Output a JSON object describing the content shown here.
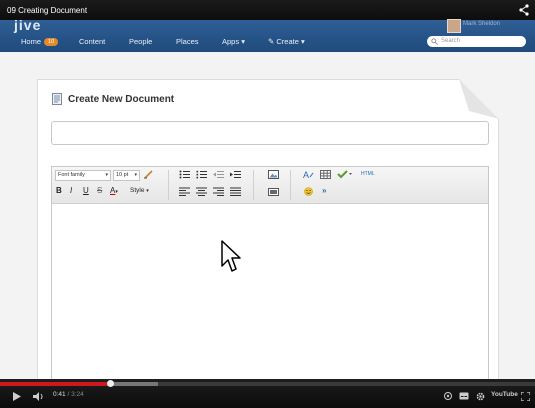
{
  "video": {
    "title": "09 Creating Document",
    "current_time": "0:41",
    "duration": "3:24",
    "progress": 0.206,
    "buffered": 0.295,
    "youtube_label": "YouTube"
  },
  "app": {
    "logo": "jive",
    "user_name": "Mark Sheldon"
  },
  "nav": {
    "home": "Home",
    "home_badge": "10",
    "content": "Content",
    "people": "People",
    "places": "Places",
    "apps": "Apps",
    "create": "Create",
    "search_placeholder": "Search"
  },
  "page": {
    "title": "Create New Document",
    "subject_value": ""
  },
  "toolbar": {
    "font_family": "Font family",
    "font_size": "10 pt",
    "bold": "B",
    "italic": "I",
    "underline": "U",
    "strike": "S",
    "text_color": "A",
    "style": "Style",
    "html": "HTML",
    "more": "»"
  },
  "colors": {
    "header_blue": "#2a5a8f",
    "progress_red": "#cc181e",
    "badge_orange": "#e38a2b"
  }
}
